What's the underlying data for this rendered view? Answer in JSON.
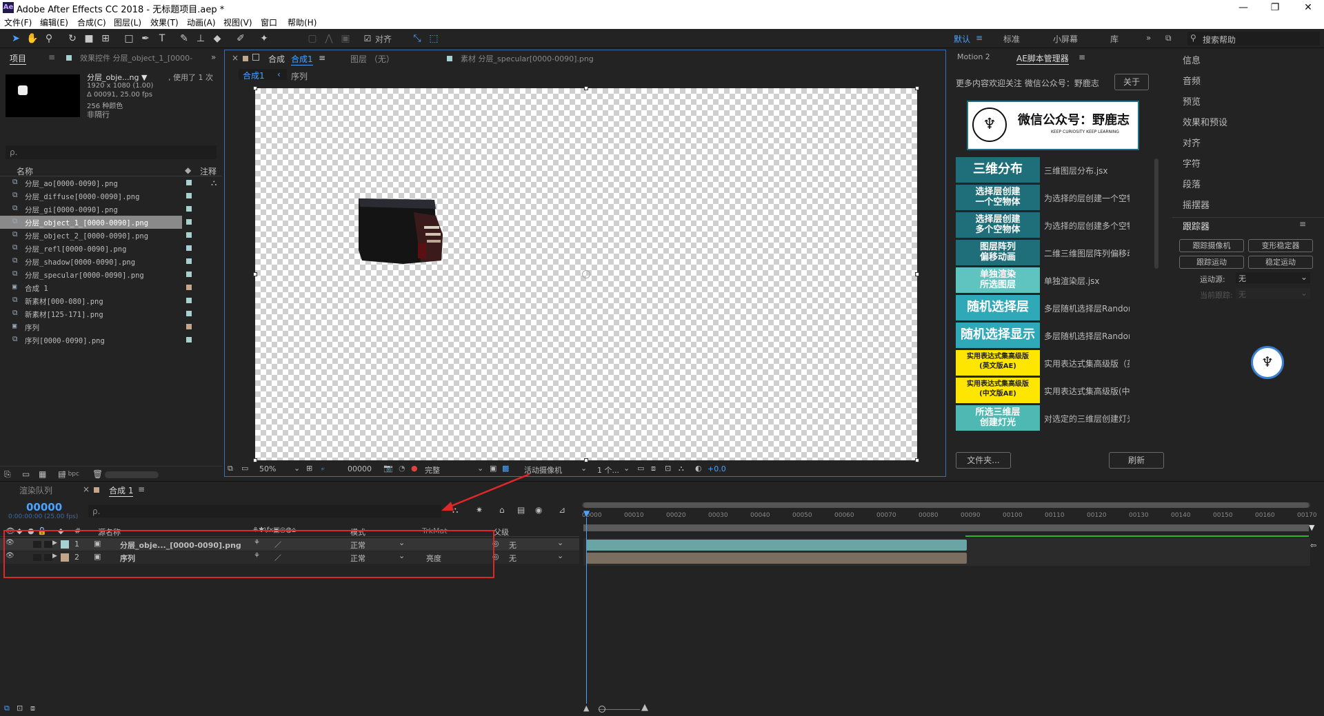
{
  "window": {
    "title": "Adobe After Effects CC 2018 - 无标题项目.aep *",
    "app_icon": "Ae"
  },
  "menu": [
    "文件(F)",
    "编辑(E)",
    "合成(C)",
    "图层(L)",
    "效果(T)",
    "动画(A)",
    "视图(V)",
    "窗口",
    "帮助(H)"
  ],
  "toolbar": {
    "align_label": "对齐",
    "workspaces": [
      "默认",
      "标准",
      "小屏幕",
      "库"
    ],
    "search_placeholder": "搜索帮助"
  },
  "project": {
    "tab": "项目",
    "effects_tab": "效果控件 分层_object_1_[0000-",
    "item_name": "分层_obje...ng ▼",
    "used": ", 使用了 1 次",
    "info": [
      "1920 x 1080 (1.00)",
      "Δ 00091, 25.00 fps",
      "256 种颜色",
      "非隔行"
    ],
    "search_placeholder": "ρ.",
    "col_name": "名称",
    "col_note": "注释",
    "bpc": "8 bpc",
    "items": [
      {
        "name": "分层_ao[0000-0090].png",
        "color": "#a7d0d0"
      },
      {
        "name": "分层_diffuse[0000-0090].png",
        "color": "#a7d0d0"
      },
      {
        "name": "分层_gi[0000-0090].png",
        "color": "#a7d0d0"
      },
      {
        "name": "分层_object_1_[0000-0090].png",
        "color": "#a7d0d0"
      },
      {
        "name": "分层_object_2_[0000-0090].png",
        "color": "#a7d0d0"
      },
      {
        "name": "分层_refl[0000-0090].png",
        "color": "#a7d0d0"
      },
      {
        "name": "分层_shadow[0000-0090].png",
        "color": "#a7d0d0"
      },
      {
        "name": "分层_specular[0000-0090].png",
        "color": "#a7d0d0"
      },
      {
        "name": "合成 1",
        "color": "#c4a68a"
      },
      {
        "name": "新素材[000-080].png",
        "color": "#a7d0d0"
      },
      {
        "name": "新素材[125-171].png",
        "color": "#a7d0d0"
      },
      {
        "name": "序列",
        "color": "#c4a68a"
      },
      {
        "name": "序列[0000-0090].png",
        "color": "#a7d0d0"
      }
    ]
  },
  "viewer": {
    "comp_tab_prefix": "合成",
    "comp_tab_name": "合成1",
    "layer_tab": "图层 （无）",
    "footage_tab": "素材 分层_specular[0000-0090].png",
    "crumb1": "合成1",
    "crumb2": "序列",
    "zoom": "50%",
    "timecode": "00000",
    "quality": "完整",
    "camera": "活动摄像机",
    "views": "1 个...",
    "exposure": "+0.0"
  },
  "scripts": {
    "tab1": "Motion 2",
    "tab2": "AE脚本管理器",
    "notice": "更多内容欢迎关注 微信公众号：野鹿志",
    "about": "关于",
    "banner_title": "微信公众号：野鹿志",
    "banner_sub": "KEEP CURIOSITY KEEP LEARNING",
    "folder_btn": "文件夹...",
    "refresh_btn": "刷新",
    "items": [
      {
        "label": "三维分布",
        "desc": "三维图层分布.jsx",
        "bg": "#1e6f7a",
        "small": false
      },
      {
        "label": "选择层创建\n一个空物体",
        "desc": "为选择的层创建一个空物体",
        "bg": "#1e6f7a",
        "small": false
      },
      {
        "label": "选择层创建\n多个空物体",
        "desc": "为选择的层创建多个空物体",
        "bg": "#1e6f7a",
        "small": false
      },
      {
        "label": "图层阵列\n偏移动画",
        "desc": "二维三维图层阵列偏移动画",
        "bg": "#1e6f7a",
        "small": false
      },
      {
        "label": "单独渲染\n所选图层",
        "desc": "单独渲染层.jsx",
        "bg": "#5fc4c0",
        "small": false
      },
      {
        "label": "随机选择层",
        "desc": "多层随机选择层RandomLayer",
        "bg": "#2fa9b8",
        "small": false
      },
      {
        "label": "随机选择显示",
        "desc": "多层随机选择层Randomly_En",
        "bg": "#2fa9b8",
        "small": false
      },
      {
        "label": "实用表达式集高级版\n(英文版AE)",
        "desc": "实用表达式集高级版（英文",
        "bg": "#ffe600",
        "small": true
      },
      {
        "label": "实用表达式集高级版\n(中文版AE)",
        "desc": "实用表达式集高级版(中文版",
        "bg": "#ffe600",
        "small": true
      },
      {
        "label": "所选三维层\n创建灯光",
        "desc": "对选定的三维层创建灯光Lig",
        "bg": "#4eb8b2",
        "small": false
      }
    ]
  },
  "right_panel": {
    "items": [
      "信息",
      "音频",
      "预览",
      "效果和预设",
      "对齐",
      "字符",
      "段落",
      "摇摆器"
    ],
    "tracker_title": "跟踪器",
    "buttons": [
      "跟踪摄像机",
      "变形稳定器",
      "跟踪运动",
      "稳定运动"
    ],
    "motion_source_label": "运动源:",
    "motion_source_value": "无",
    "current_track_label": "当前跟踪:",
    "current_track_value": "无"
  },
  "timeline": {
    "render_tab": "渲染队列",
    "comp_tab": "合成 1",
    "timecode": "00000",
    "timecode_sub": "0:00:00:00 (25.00 fps)",
    "search_placeholder": "ρ.",
    "col_source": "源名称",
    "col_mode": "模式",
    "col_trkmat": "TrkMat",
    "col_parent": "父级",
    "layers": [
      {
        "num": "1",
        "name": "分层_obje..._[0000-0090].png",
        "mode": "正常",
        "trkmat": "",
        "parent": "无",
        "color": "#a7d0d0"
      },
      {
        "num": "2",
        "name": "序列",
        "mode": "正常",
        "trkmat": "亮度",
        "parent": "无",
        "color": "#c4a68a"
      }
    ],
    "ticks": [
      "00000",
      "00010",
      "00020",
      "00030",
      "00040",
      "00050",
      "00060",
      "00070",
      "00080",
      "00090",
      "00100",
      "00110",
      "00120",
      "00130",
      "00140",
      "00150",
      "00160",
      "00170"
    ]
  }
}
